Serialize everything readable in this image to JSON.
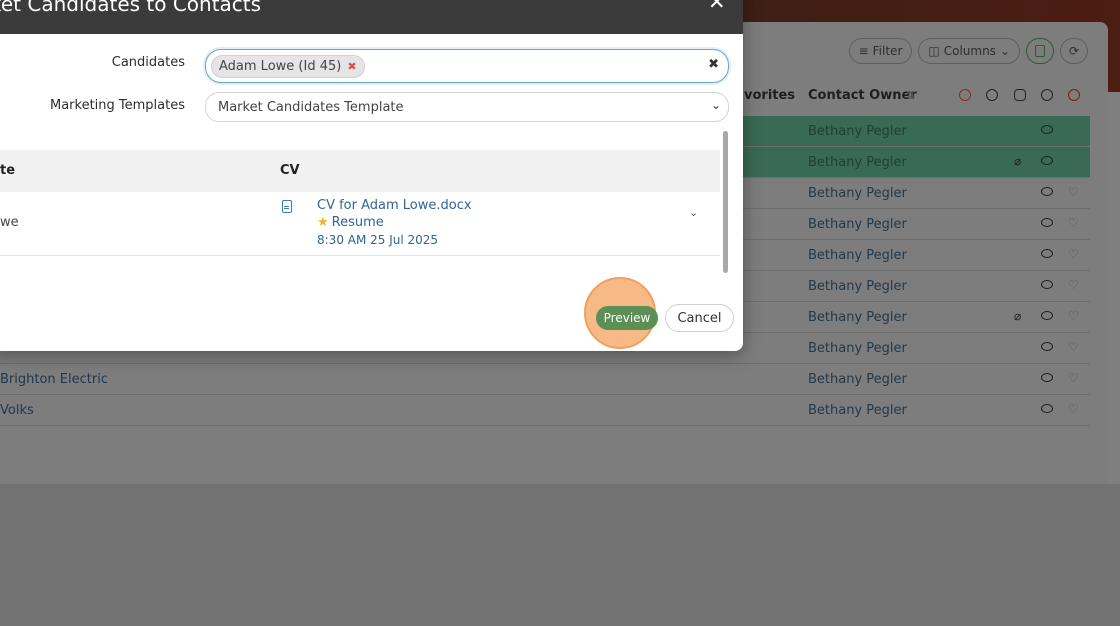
{
  "modal": {
    "title": "ket Candidates to Contacts",
    "close_glyph": "✕",
    "candidates_label": "Candidates",
    "selected_candidate": "Adam Lowe (Id 45)",
    "chip_remove_glyph": "✖",
    "clear_glyph": "✖",
    "templates_label": "Marketing Templates",
    "template_value": "Market Candidates Template",
    "table": {
      "col_candidate": "te",
      "col_cv": "CV",
      "rows": [
        {
          "candidate": "we",
          "cv_file": "CV for Adam Lowe.docx",
          "cv_type": "Resume",
          "cv_date": "8:30 AM 25 Jul 2025"
        }
      ]
    },
    "preview_label": "Preview",
    "cancel_label": "Cancel"
  },
  "background": {
    "toolbar": {
      "filter": "Filter",
      "columns": "Columns"
    },
    "header": {
      "favorites": "vorites",
      "contact_owner": "Contact Owner"
    },
    "owner_name": "Bethany Pegler",
    "rows": [
      {
        "left": "",
        "highlight": true,
        "clip": false
      },
      {
        "left": "",
        "highlight": true,
        "clip": true
      },
      {
        "left": "",
        "highlight": false,
        "clip": false
      },
      {
        "left": "",
        "highlight": false,
        "clip": false
      },
      {
        "left": "",
        "highlight": false,
        "clip": false
      },
      {
        "left": "",
        "highlight": false,
        "clip": false
      },
      {
        "left": "",
        "highlight": false,
        "clip": true
      },
      {
        "left": "",
        "highlight": false,
        "clip": false
      },
      {
        "left": "Brighton Electric",
        "highlight": false,
        "clip": false
      },
      {
        "left": "Volks",
        "highlight": false,
        "clip": false
      }
    ]
  },
  "colors": {
    "accent_green": "#5b8f54",
    "focus_blue": "#6ea3cc",
    "link_blue": "#2f6497",
    "highlight_orange": "#f6b27a"
  }
}
